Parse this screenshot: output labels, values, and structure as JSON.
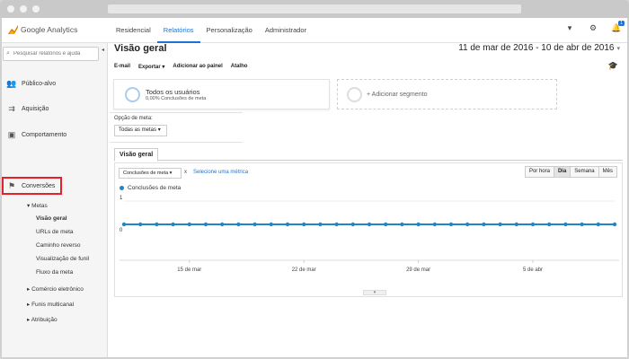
{
  "app": {
    "logo_text": "Google Analytics",
    "nav_tabs": [
      {
        "label": "Residencial",
        "active": false
      },
      {
        "label": "Relatórios",
        "active": true
      },
      {
        "label": "Personalização",
        "active": false
      },
      {
        "label": "Administrador",
        "active": false
      }
    ],
    "notification_count": "1",
    "accent_color": "#1e73d2"
  },
  "sidebar": {
    "search_placeholder": "Pesquisar relatórios e ajuda",
    "items": [
      {
        "label": "Público-alvo",
        "icon": "people-icon"
      },
      {
        "label": "Aquisição",
        "icon": "arrows-icon"
      },
      {
        "label": "Comportamento",
        "icon": "window-icon"
      },
      {
        "label": "Conversões",
        "icon": "flag-icon"
      }
    ],
    "metas_label": "Metas",
    "metas_subitems": [
      "Visão geral",
      "URLs de meta",
      "Caminho reverso",
      "Visualização de funil",
      "Fluxo da meta"
    ],
    "other_sections": [
      "Comércio eletrônico",
      "Funis multicanal",
      "Atribuição"
    ]
  },
  "main": {
    "title": "Visão geral",
    "date_range": "11 de mar de 2016 - 10 de abr de 2016",
    "toolbar": [
      "E-mail",
      "Exportar",
      "Adicionar ao painel",
      "Atalho"
    ],
    "segment": {
      "title": "Todos os usuários",
      "subtitle": "0,00% Conclusões de meta"
    },
    "add_segment": "+ Adicionar segmento",
    "goal_option_label": "Opção de meta:",
    "goal_option_value": "Todas as metas",
    "tab_label": "Visão geral",
    "metric_select": "Conclusões de meta",
    "metric_remove": "x",
    "select_metric_link": "Selecione uma métrica",
    "granularity": [
      {
        "label": "Por hora",
        "active": false
      },
      {
        "label": "Dia",
        "active": true
      },
      {
        "label": "Semana",
        "active": false
      },
      {
        "label": "Mês",
        "active": false
      }
    ],
    "legend_label": "Conclusões de meta"
  },
  "chart_data": {
    "type": "line",
    "title": "",
    "xlabel": "",
    "ylabel": "",
    "ylim": [
      0,
      1
    ],
    "y_ticks": [
      "1",
      "0"
    ],
    "x_tick_labels": [
      "15 de mar",
      "22 de mar",
      "29 de mar",
      "5 de abr"
    ],
    "series": [
      {
        "name": "Conclusões de meta",
        "color": "#1f86c8",
        "values": [
          0,
          0,
          0,
          0,
          0,
          0,
          0,
          0,
          0,
          0,
          0,
          0,
          0,
          0,
          0,
          0,
          0,
          0,
          0,
          0,
          0,
          0,
          0,
          0,
          0,
          0,
          0,
          0,
          0,
          0,
          0
        ]
      }
    ]
  }
}
